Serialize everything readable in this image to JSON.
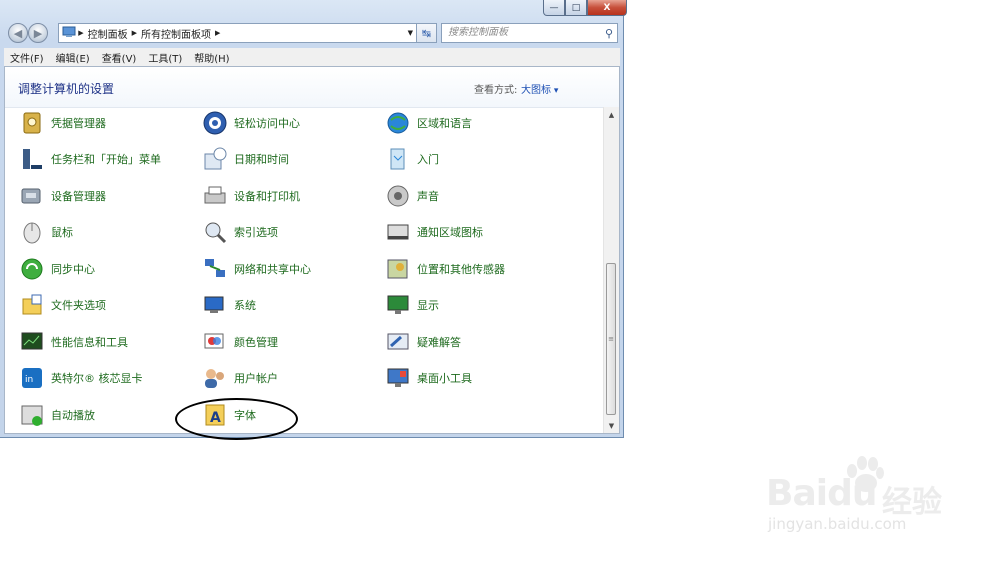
{
  "window": {
    "controls": {
      "minimize": "—",
      "maximize": "□",
      "close": "X"
    }
  },
  "address": {
    "back_icon": "back-arrow-icon",
    "forward_icon": "forward-arrow-icon",
    "breadcrumb": [
      "控制面板",
      "所有控制面板项"
    ],
    "search_placeholder": "搜索控制面板"
  },
  "menu": [
    {
      "label": "文件(F)"
    },
    {
      "label": "编辑(E)"
    },
    {
      "label": "查看(V)"
    },
    {
      "label": "工具(T)"
    },
    {
      "label": "帮助(H)"
    }
  ],
  "header": {
    "title": "调整计算机的设置",
    "view_by_label": "查看方式:",
    "view_by_value": "大图标"
  },
  "items": [
    {
      "label": "凭据管理器",
      "icon": "credential-vault-icon"
    },
    {
      "label": "任务栏和「开始」菜单",
      "icon": "taskbar-icon"
    },
    {
      "label": "设备管理器",
      "icon": "device-manager-icon"
    },
    {
      "label": "鼠标",
      "icon": "mouse-icon"
    },
    {
      "label": "同步中心",
      "icon": "sync-center-icon"
    },
    {
      "label": "文件夹选项",
      "icon": "folder-options-icon"
    },
    {
      "label": "性能信息和工具",
      "icon": "performance-icon"
    },
    {
      "label": "英特尔® 核芯显卡",
      "icon": "intel-graphics-icon"
    },
    {
      "label": "自动播放",
      "icon": "autoplay-icon"
    },
    {
      "label": "轻松访问中心",
      "icon": "ease-of-access-icon"
    },
    {
      "label": "日期和时间",
      "icon": "date-time-icon"
    },
    {
      "label": "设备和打印机",
      "icon": "printer-icon"
    },
    {
      "label": "索引选项",
      "icon": "indexing-icon"
    },
    {
      "label": "网络和共享中心",
      "icon": "network-icon"
    },
    {
      "label": "系统",
      "icon": "system-icon"
    },
    {
      "label": "颜色管理",
      "icon": "color-management-icon"
    },
    {
      "label": "用户帐户",
      "icon": "user-accounts-icon"
    },
    {
      "label": "字体",
      "icon": "fonts-icon"
    },
    {
      "label": "区域和语言",
      "icon": "region-language-icon"
    },
    {
      "label": "入门",
      "icon": "getting-started-icon"
    },
    {
      "label": "声音",
      "icon": "sound-icon"
    },
    {
      "label": "通知区域图标",
      "icon": "notification-icons-icon"
    },
    {
      "label": "位置和其他传感器",
      "icon": "location-sensor-icon"
    },
    {
      "label": "显示",
      "icon": "display-icon"
    },
    {
      "label": "疑难解答",
      "icon": "troubleshooting-icon"
    },
    {
      "label": "桌面小工具",
      "icon": "gadgets-icon"
    }
  ],
  "watermark": {
    "brand": "Baidu",
    "brand_cn": "经验",
    "url": "jingyan.baidu.com"
  },
  "colors": {
    "item_text": "#1e6a1e",
    "title_text": "#1e3287",
    "link_blue": "#1e50b4"
  }
}
